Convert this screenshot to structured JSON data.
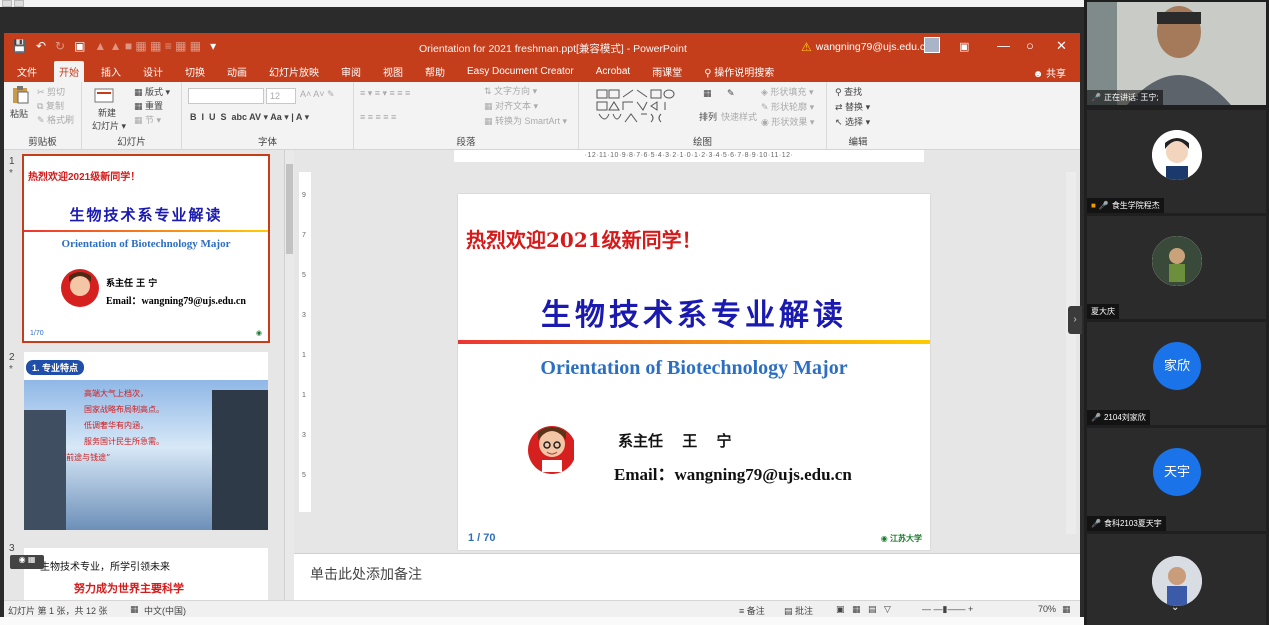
{
  "ppt": {
    "title": "Orientation for 2021 freshman.ppt[兼容模式] - PowerPoint",
    "account": "wangning79@ujs.edu.cn",
    "tabs": [
      "文件",
      "开始",
      "插入",
      "设计",
      "切换",
      "动画",
      "幻灯片放映",
      "审阅",
      "视图",
      "帮助",
      "Easy Document Creator",
      "Acrobat",
      "雨课堂",
      "操作说明搜索"
    ],
    "share_label": "共享",
    "ribbon": {
      "clipboard": {
        "label": "剪贴板",
        "paste": "粘贴",
        "cut": "剪切",
        "copy": "复制",
        "format_painter": "格式刷"
      },
      "slides": {
        "label": "幻灯片",
        "new_slide": "新建\n幻灯片",
        "layout": "版式",
        "reset": "重置",
        "section": "节"
      },
      "font": {
        "label": "字体",
        "size": "12"
      },
      "paragraph": {
        "label": "段落",
        "text_direction": "文字方向",
        "align_text": "对齐文本",
        "smartart": "转换为 SmartArt"
      },
      "drawing": {
        "label": "绘图",
        "arrange": "排列",
        "quick_styles": "快速样式",
        "fill": "形状填充",
        "outline": "形状轮廓",
        "effects": "形状效果"
      },
      "editing": {
        "label": "编辑",
        "find": "查找",
        "replace": "替换",
        "select": "选择"
      }
    },
    "ruler_text": "·12·11·10·9·8·7·6·5·4·3·2·1·0·1·2·3·4·5·6·7·8·9·10·11·12·",
    "thumbnails": [
      {
        "num": "1",
        "welcome": "热烈欢迎2021级新同学！",
        "title": "生物技术系专业解读",
        "subtitle": "Orientation of Biotechnology Major",
        "director": "系主任   王 宁",
        "email": "Email：wangning79@ujs.edu.cn",
        "page": "1/70"
      },
      {
        "num": "2",
        "heading": "1. 专业特点",
        "lines": [
          "高端大气上档次，",
          "国家战略布局制高点。",
          "低调奢华有内涵，",
          "服务国计民生所急需。",
          "“前途与钱途”"
        ]
      },
      {
        "num": "3",
        "line1": "生物技术专业，所学引领未来",
        "line2": "努力成为世界主要科学"
      }
    ],
    "slide": {
      "welcome": "热烈欢迎2021级新同学！",
      "title": "生物技术系专业解读",
      "subtitle": "Orientation of Biotechnology Major",
      "director_label": "系主任",
      "director_name": "王 宁",
      "email": "Email：wangning79@ujs.edu.cn",
      "page": "1 / 70",
      "logo": "江苏大学"
    },
    "notes_placeholder": "单击此处添加备注",
    "status": {
      "slide_info": "幻灯片 第 1 张，共 12 张",
      "language": "中文(中国)",
      "notes": "备注",
      "comments": "批注",
      "zoom": "70%"
    }
  },
  "participants": [
    {
      "name": "正在讲话: 王宁;",
      "type": "video"
    },
    {
      "name": "食生学院程杰",
      "type": "avatar"
    },
    {
      "name": "夏大庆",
      "type": "avatar"
    },
    {
      "name": "2104刘家欣",
      "type": "circle",
      "initials": "家欣"
    },
    {
      "name": "食科2103夏天宇",
      "type": "circle",
      "initials": "天宇"
    },
    {
      "name": "",
      "type": "avatar"
    }
  ],
  "colors": {
    "ppt_accent": "#c43e1c",
    "circle_blue": "#1a73e8"
  }
}
